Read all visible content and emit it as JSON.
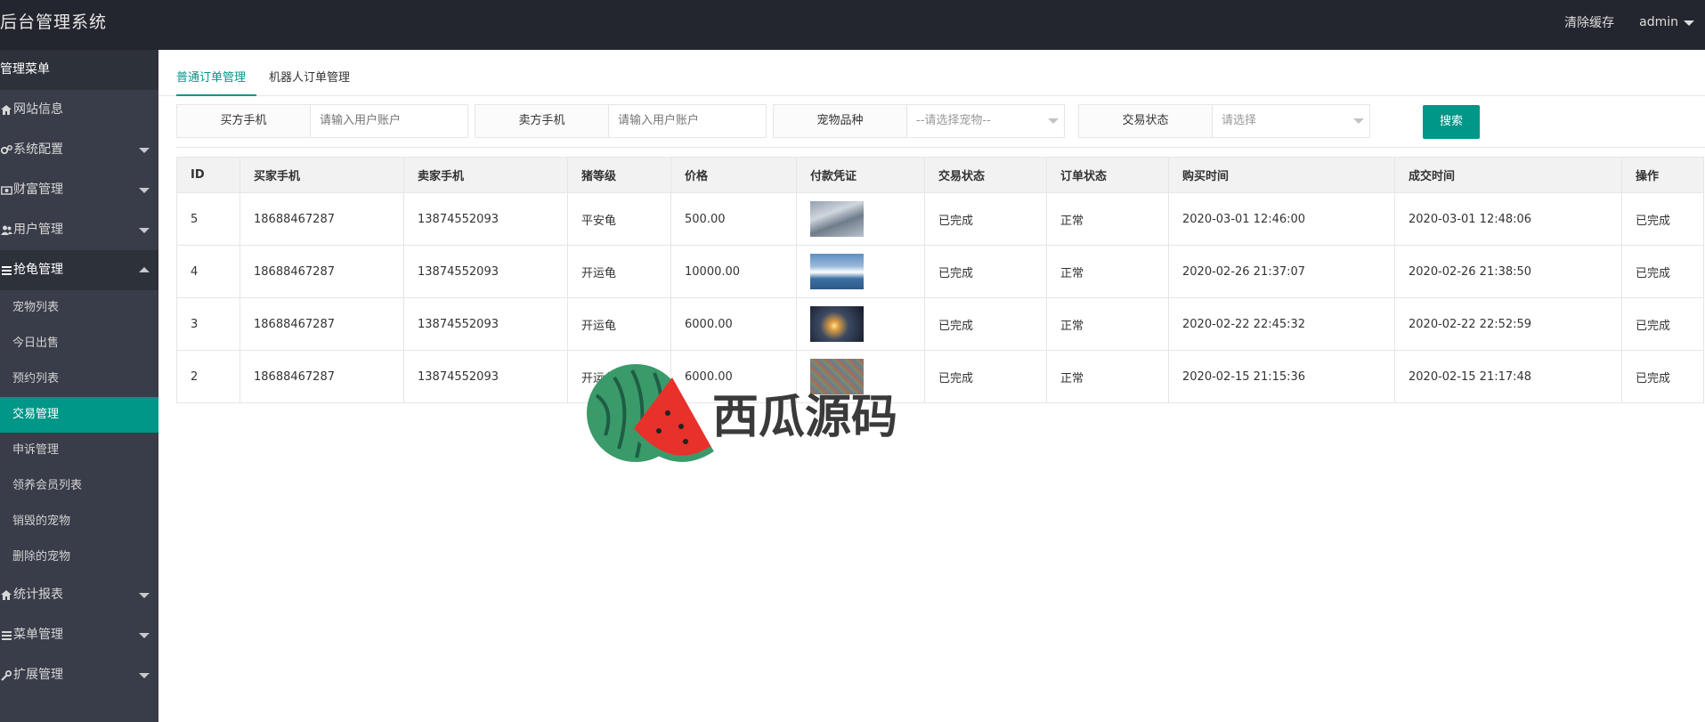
{
  "header": {
    "brand": "后台管理系统",
    "clear_cache": "清除缓存",
    "user": "admin"
  },
  "sidebar": {
    "title": "管理菜单",
    "items": [
      {
        "label": "网站信息",
        "icon": "home-icon"
      },
      {
        "label": "系统配置",
        "icon": "gears-icon"
      },
      {
        "label": "财富管理",
        "icon": "money-icon"
      },
      {
        "label": "用户管理",
        "icon": "users-icon"
      },
      {
        "label": "抢龟管理",
        "icon": "list-icon"
      },
      {
        "label": "统计报表",
        "icon": "home-icon"
      },
      {
        "label": "菜单管理",
        "icon": "list-icon"
      },
      {
        "label": "扩展管理",
        "icon": "wrench-icon"
      }
    ],
    "sub_items": [
      "宠物列表",
      "今日出售",
      "预约列表",
      "交易管理",
      "申诉管理",
      "领养会员列表",
      "销毁的宠物",
      "删除的宠物"
    ],
    "active_sub": "交易管理"
  },
  "tabs": [
    "普通订单管理",
    "机器人订单管理"
  ],
  "search": {
    "buyer_label": "买方手机",
    "buyer_placeholder": "请输入用户账户",
    "seller_label": "卖方手机",
    "seller_placeholder": "请输入用户账户",
    "pet_label": "宠物品种",
    "pet_value": "--请选择宠物--",
    "status_label": "交易状态",
    "status_value": "请选择",
    "button": "搜索"
  },
  "table": {
    "columns": [
      "ID",
      "买家手机",
      "卖家手机",
      "猪等级",
      "价格",
      "付款凭证",
      "交易状态",
      "订单状态",
      "购买时间",
      "成交时间",
      "操作"
    ],
    "rows": [
      {
        "id": "5",
        "buyer": "18688467287",
        "seller": "13874552093",
        "level": "平安龟",
        "price": "500.00",
        "status": "已完成",
        "order_status": "正常",
        "buy_time": "2020-03-01 12:46:00",
        "done_time": "2020-03-01 12:48:06",
        "action": "已完成"
      },
      {
        "id": "4",
        "buyer": "18688467287",
        "seller": "13874552093",
        "level": "开运龟",
        "price": "10000.00",
        "status": "已完成",
        "order_status": "正常",
        "buy_time": "2020-02-26 21:37:07",
        "done_time": "2020-02-26 21:38:50",
        "action": "已完成"
      },
      {
        "id": "3",
        "buyer": "18688467287",
        "seller": "13874552093",
        "level": "开运龟",
        "price": "6000.00",
        "status": "已完成",
        "order_status": "正常",
        "buy_time": "2020-02-22 22:45:32",
        "done_time": "2020-02-22 22:52:59",
        "action": "已完成"
      },
      {
        "id": "2",
        "buyer": "18688467287",
        "seller": "13874552093",
        "level": "开运龟",
        "price": "6000.00",
        "status": "已完成",
        "order_status": "正常",
        "buy_time": "2020-02-15 21:15:36",
        "done_time": "2020-02-15 21:17:48",
        "action": "已完成"
      }
    ]
  },
  "watermark": {
    "text": "西瓜源码"
  },
  "colors": {
    "accent": "#009688",
    "header_bg": "#23262e",
    "sidebar_bg": "#393d49"
  }
}
